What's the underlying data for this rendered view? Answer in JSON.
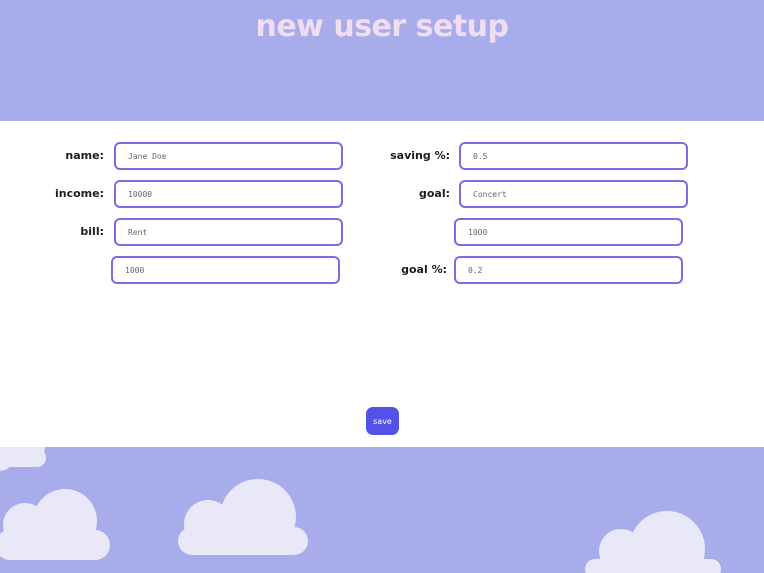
{
  "header": {
    "title": "new user setup"
  },
  "form": {
    "name_label": "name:",
    "name_value": "Jane Doe",
    "income_label": "income:",
    "income_value": "10000",
    "bill_label": "bill:",
    "bill_name_value": "Rent",
    "bill_amount_value": "1000",
    "saving_label": "saving %:",
    "saving_value": "0.5",
    "goal_label": "goal:",
    "goal_name_value": "Concert",
    "goal_amount_value": "1000",
    "goal_percent_label": "goal %:",
    "goal_percent_value": "0.2"
  },
  "actions": {
    "save_label": "save"
  },
  "colors": {
    "banner": "#a8aceb",
    "title": "#f1ddf0",
    "field_border": "#7b6ce6",
    "save_button": "#5352e6",
    "cloud": "#e8e8f8"
  },
  "decorations": [
    "cloud-icon",
    "cloud-icon",
    "cloud-icon",
    "cloud-icon"
  ]
}
